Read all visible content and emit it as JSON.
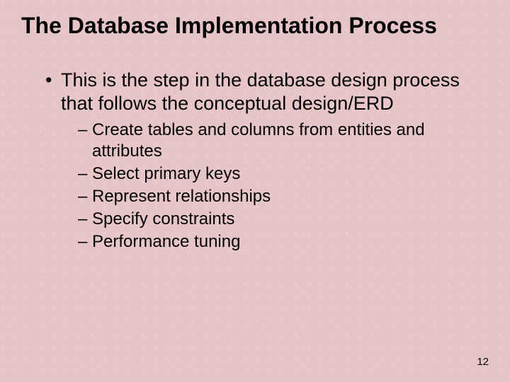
{
  "title": "The Database Implementation Process",
  "bullets": {
    "main": "This is the step in the database design process that follows the conceptual design/ERD",
    "subs": [
      "Create tables and columns from entities and attributes",
      "Select primary keys",
      "Represent relationships",
      "Specify constraints",
      "Performance tuning"
    ]
  },
  "page_number": "12"
}
